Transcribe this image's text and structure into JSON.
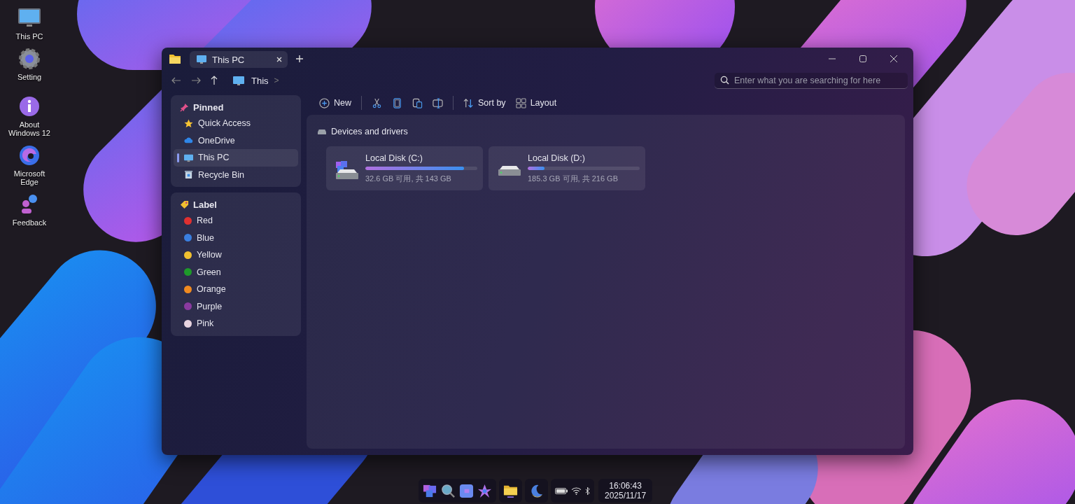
{
  "desktop_icons": [
    {
      "label": "This PC",
      "kind": "pc"
    },
    {
      "label": "Setting",
      "kind": "settings"
    },
    {
      "label": "About Windows 12",
      "kind": "info"
    },
    {
      "label": "Microsoft Edge",
      "kind": "edge"
    },
    {
      "label": "Feedback",
      "kind": "feedback"
    }
  ],
  "window": {
    "tabs": [
      {
        "label": "This PC",
        "selected": true
      }
    ],
    "breadcrumb": {
      "label": "This",
      "separator": ">"
    },
    "search": {
      "placeholder": "Enter what you are searching for here"
    }
  },
  "sidebar": {
    "pinned": {
      "title": "Pinned",
      "items": [
        {
          "label": "Quick Access",
          "kind": "star",
          "selected": false
        },
        {
          "label": "OneDrive",
          "kind": "cloud",
          "selected": false
        },
        {
          "label": "This PC",
          "kind": "pc",
          "selected": true
        },
        {
          "label": "Recycle Bin",
          "kind": "bin",
          "selected": false
        }
      ]
    },
    "labels": {
      "title": "Label",
      "items": [
        {
          "label": "Red",
          "color": "#e03030"
        },
        {
          "label": "Blue",
          "color": "#3a7fe0"
        },
        {
          "label": "Yellow",
          "color": "#f0c030"
        },
        {
          "label": "Green",
          "color": "#1e9a2a"
        },
        {
          "label": "Orange",
          "color": "#f08a20"
        },
        {
          "label": "Purple",
          "color": "#8a3aa0"
        },
        {
          "label": "Pink",
          "color": "#e8d4e0"
        }
      ]
    }
  },
  "toolbar": [
    {
      "kind": "new",
      "label": "New"
    },
    {
      "kind": "separator"
    },
    {
      "kind": "cut"
    },
    {
      "kind": "copy"
    },
    {
      "kind": "paste"
    },
    {
      "kind": "rename"
    },
    {
      "kind": "separator"
    },
    {
      "kind": "sort",
      "label": "Sort by"
    },
    {
      "kind": "layout",
      "label": "Layout"
    }
  ],
  "devices": {
    "title": "Devices and drivers",
    "drives": [
      {
        "name": "Local Disk (C:)",
        "kind": "system",
        "level": 0.88,
        "info": "32.6 GB 可用, 共 143 GB"
      },
      {
        "name": "Local Disk (D:)",
        "kind": "data",
        "level": 0.15,
        "info": "185.3 GB 可用, 共 216 GB"
      }
    ]
  },
  "taskbar": {
    "groups": [
      [
        {
          "kind": "start"
        },
        {
          "kind": "search"
        },
        {
          "kind": "widgets"
        },
        {
          "kind": "copilot"
        }
      ],
      [
        {
          "kind": "explorer"
        }
      ],
      [
        {
          "kind": "moon"
        }
      ]
    ],
    "clock": {
      "time": "16:06:43",
      "date": "2025/11/17"
    }
  }
}
